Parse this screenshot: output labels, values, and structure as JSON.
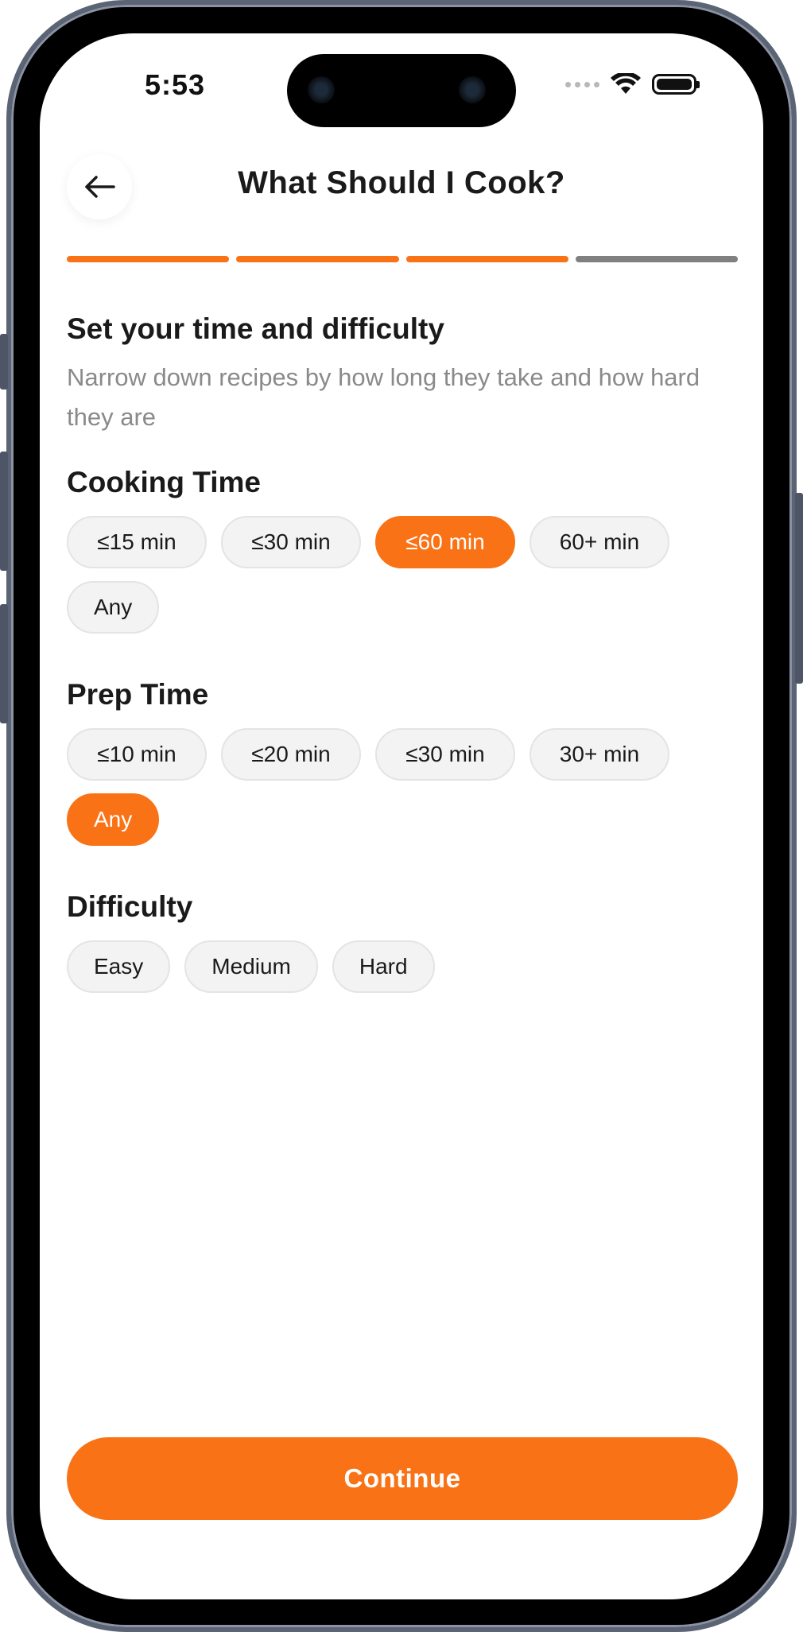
{
  "status_bar": {
    "time": "5:53",
    "signal_icon": "signal-dots-icon",
    "wifi_icon": "wifi-icon",
    "battery_icon": "battery-icon"
  },
  "header": {
    "title": "What Should I Cook?",
    "back_icon": "arrow-left-icon"
  },
  "progress": {
    "total_steps": 4,
    "completed_steps": 3,
    "active_color": "#f97316",
    "inactive_color": "#808080"
  },
  "intro": {
    "title": "Set your time and difficulty",
    "subtitle": "Narrow down recipes by how long they take and how hard they are"
  },
  "cooking_time": {
    "title": "Cooking Time",
    "options": [
      "≤15 min",
      "≤30 min",
      "≤60 min",
      "60+ min",
      "Any"
    ],
    "selected": "≤60 min"
  },
  "prep_time": {
    "title": "Prep Time",
    "options": [
      "≤10 min",
      "≤20 min",
      "≤30 min",
      "30+ min",
      "Any"
    ],
    "selected": "Any"
  },
  "difficulty": {
    "title": "Difficulty",
    "options": [
      "Easy",
      "Medium",
      "Hard"
    ],
    "selected": ""
  },
  "footer": {
    "continue_label": "Continue"
  },
  "colors": {
    "accent": "#f97316",
    "chip_bg": "#f3f3f3",
    "text": "#1a1a1a",
    "muted": "#8a8a8a"
  }
}
